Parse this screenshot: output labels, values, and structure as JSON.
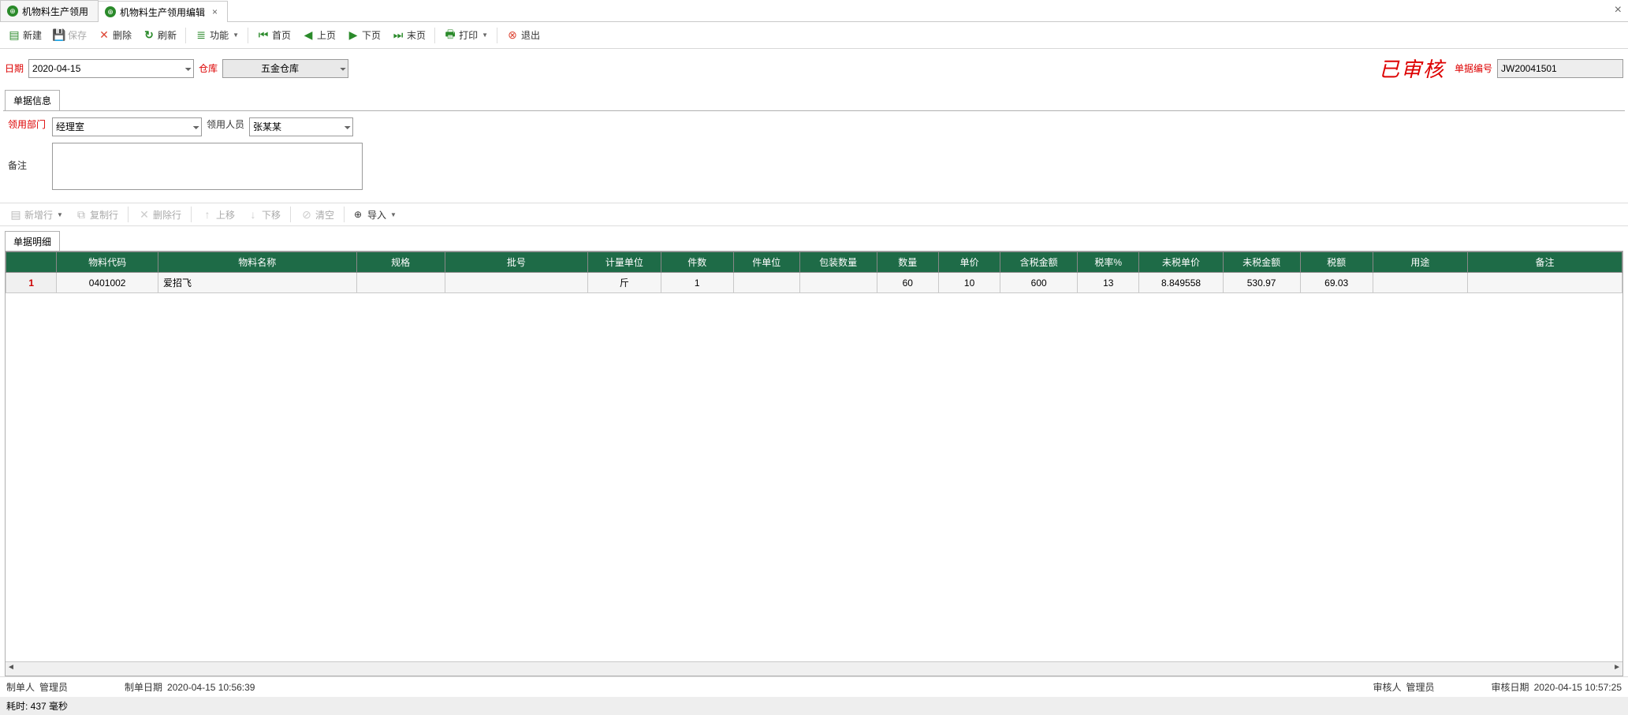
{
  "tabs": [
    {
      "label": "机物料生产领用",
      "closable": false
    },
    {
      "label": "机物料生产领用编辑",
      "closable": true,
      "active": true
    }
  ],
  "toolbar": {
    "new": "新建",
    "save": "保存",
    "delete": "删除",
    "refresh": "刷新",
    "function": "功能",
    "first": "首页",
    "prev": "上页",
    "next": "下页",
    "last": "末页",
    "print": "打印",
    "exit": "退出"
  },
  "header": {
    "date_label": "日期",
    "date_value": "2020-04-15",
    "warehouse_label": "仓库",
    "warehouse_value": "五金仓库",
    "stamp": "已审核",
    "docno_label": "单据编号",
    "docno_value": "JW20041501"
  },
  "section_info": {
    "tab_label": "单据信息",
    "dept_label": "领用部门",
    "dept_value": "经理室",
    "person_label": "领用人员",
    "person_value": "张某某",
    "remark_label": "备注",
    "remark_value": ""
  },
  "detail_toolbar": {
    "addrow": "新增行",
    "copyrow": "复制行",
    "delrow": "删除行",
    "moveup": "上移",
    "movedown": "下移",
    "clear": "清空",
    "import": "导入"
  },
  "grid": {
    "tab_label": "单据明细",
    "columns": [
      "物料代码",
      "物料名称",
      "规格",
      "批号",
      "计量单位",
      "件数",
      "件单位",
      "包装数量",
      "数量",
      "单价",
      "含税金额",
      "税率%",
      "未税单价",
      "未税金额",
      "税额",
      "用途",
      "备注"
    ],
    "rows": [
      {
        "n": "1",
        "cells": [
          "0401002",
          "爱招飞",
          "",
          "",
          "斤",
          "1",
          "",
          "",
          "60",
          "10",
          "600",
          "13",
          "8.849558",
          "530.97",
          "69.03",
          "",
          ""
        ]
      }
    ]
  },
  "footer": {
    "maker_label": "制单人",
    "maker_value": "管理员",
    "makedate_label": "制单日期",
    "makedate_value": "2020-04-15 10:56:39",
    "auditor_label": "审核人",
    "auditor_value": "管理员",
    "auditdate_label": "审核日期",
    "auditdate_value": "2020-04-15 10:57:25"
  },
  "status": "耗时: 437 毫秒"
}
